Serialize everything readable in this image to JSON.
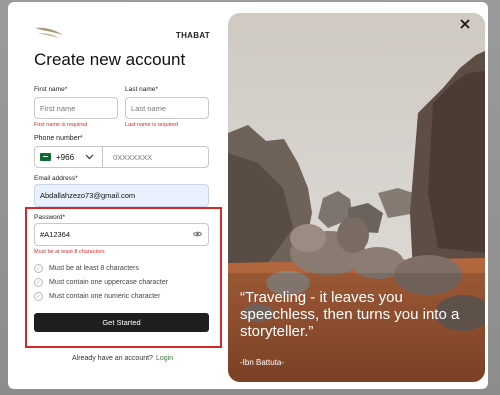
{
  "brand": "THABAT",
  "title": "Create new account",
  "first_name": {
    "label": "First name*",
    "placeholder": "First name",
    "error": "First name is required"
  },
  "last_name": {
    "label": "Last name*",
    "placeholder": "Last name",
    "error": "Last name is required"
  },
  "phone": {
    "label": "Phone number*",
    "country_code": "+966",
    "placeholder": "0XXXXXXX"
  },
  "email": {
    "label": "Email address*",
    "value": "Abdallahzezo73@gmail.com"
  },
  "password": {
    "label": "Password*",
    "value": "#A12364",
    "error": "Must be at least 8 characters",
    "rules": [
      "Must be at least 8 characters",
      "Must contain one uppercase character",
      "Must contain one numeric character"
    ]
  },
  "submit_label": "Get Started",
  "signin": {
    "text": "Already have an account?",
    "link": "Login"
  },
  "quote": {
    "text": "“Traveling - it leaves you speechless, then turns you into a storyteller.”",
    "author": "-Ibn Battuta-"
  },
  "colors": {
    "accent": "#1f1f1f",
    "error": "#d32f2f",
    "highlight": "#d62828",
    "link": "#3c7a3c"
  }
}
